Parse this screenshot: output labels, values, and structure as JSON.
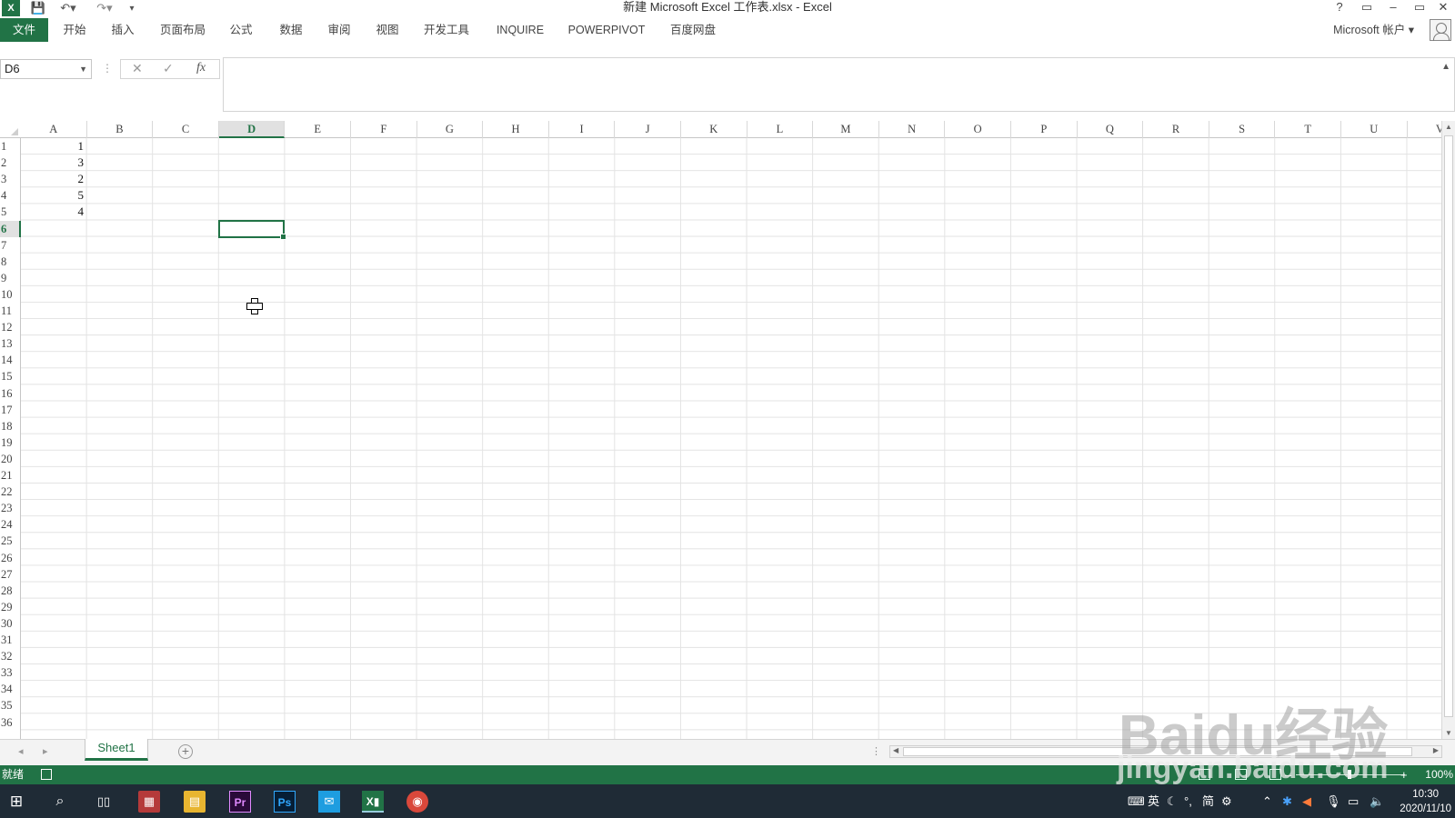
{
  "window": {
    "title": "新建 Microsoft Excel 工作表.xlsx - Excel",
    "help": "?",
    "minimize": "–",
    "restore": "▭",
    "close": "✕"
  },
  "ribbon": {
    "tabs": [
      "文件",
      "开始",
      "插入",
      "页面布局",
      "公式",
      "数据",
      "审阅",
      "视图",
      "开发工具",
      "INQUIRE",
      "POWERPIVOT",
      "百度网盘"
    ],
    "account": "Microsoft 帐户 ▾"
  },
  "formula_bar": {
    "name_box": "D6",
    "cancel_glyph": "✕",
    "enter_glyph": "✓",
    "fx_glyph": "fx",
    "content": ""
  },
  "grid": {
    "columns": [
      "A",
      "B",
      "C",
      "D",
      "E",
      "F",
      "G",
      "H",
      "I",
      "J",
      "K",
      "L",
      "M",
      "N",
      "O",
      "P",
      "Q",
      "R",
      "S",
      "T",
      "U",
      "V"
    ],
    "rows": [
      1,
      2,
      3,
      4,
      5,
      6,
      7,
      8,
      9,
      10,
      11,
      12,
      13,
      14,
      15,
      16,
      17,
      18,
      19,
      20,
      21,
      22,
      23,
      24,
      25,
      26,
      27,
      28,
      29,
      30,
      31,
      32,
      33,
      34,
      35,
      36
    ],
    "selected_cell": "D6",
    "selected_col": "D",
    "selected_row": 6,
    "column_a_values": [
      "1",
      "3",
      "2",
      "5",
      "4"
    ]
  },
  "sheets": {
    "tabs": [
      "Sheet1"
    ],
    "add": "+"
  },
  "status": {
    "ready": "就绪",
    "zoom": "100%",
    "minus": "–",
    "plus": "+"
  },
  "taskbar": {
    "ime": [
      "英",
      "简"
    ],
    "time": "10:30",
    "date": "2020/11/10"
  },
  "watermark": {
    "brand": "Bai",
    "brand2": "du经验",
    "url": "jingyan.baidu.com"
  }
}
